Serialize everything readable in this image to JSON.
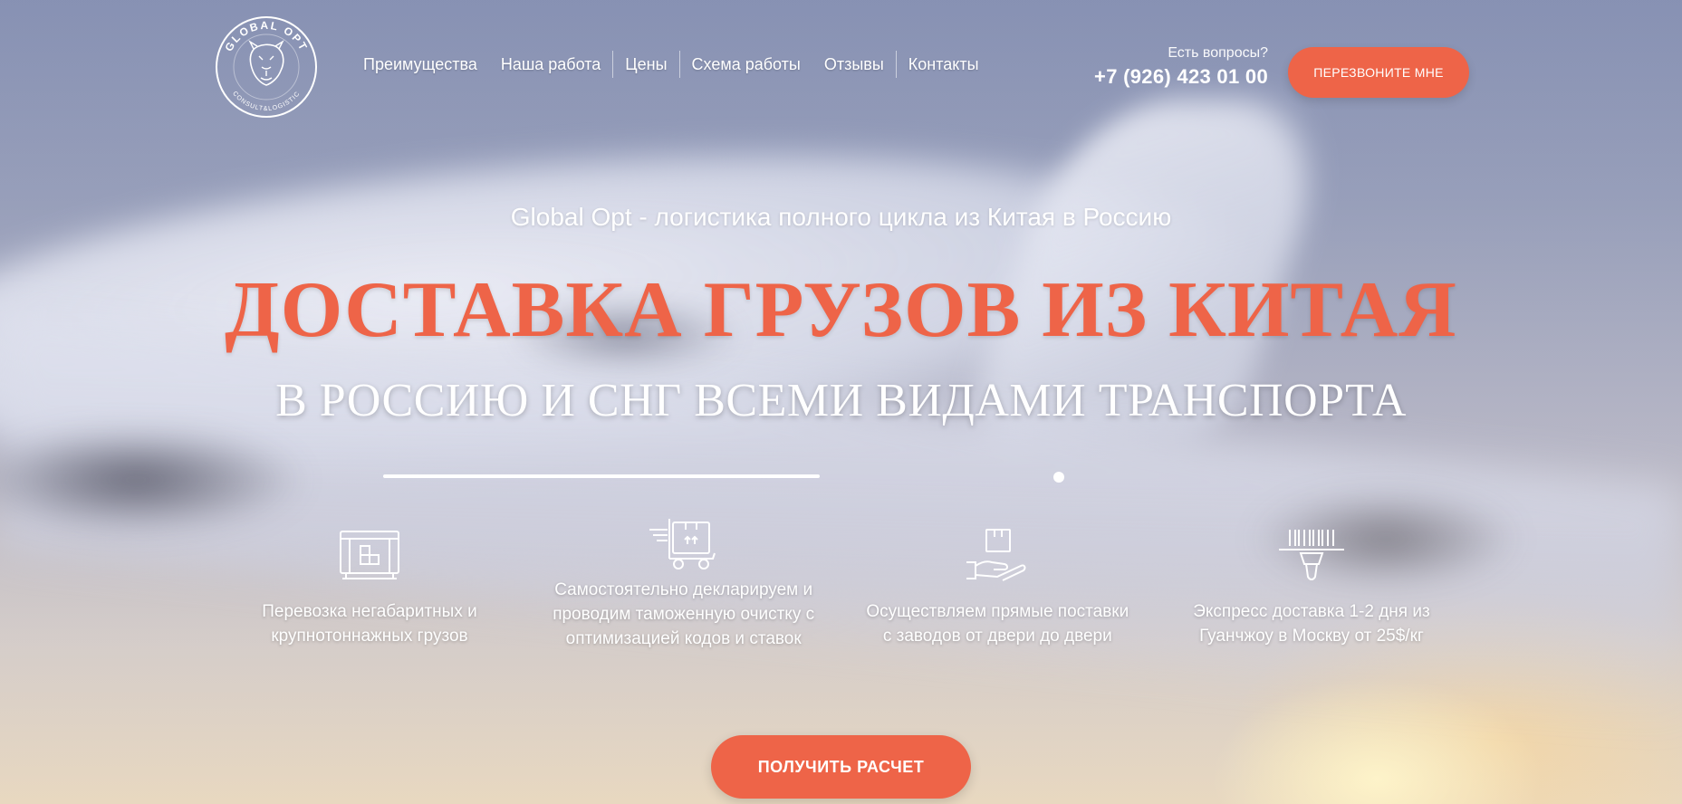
{
  "colors": {
    "accent": "#ee6448",
    "text_light": "#ffffff"
  },
  "header": {
    "logo": {
      "top_text": "GLOBAL OPT",
      "bottom_text": "CONSULT&LOGISTIC"
    },
    "nav": [
      {
        "label": "Преимущества"
      },
      {
        "label": "Наша работа"
      },
      {
        "label": "Цены"
      },
      {
        "label": "Схема работы"
      },
      {
        "label": "Отзывы"
      },
      {
        "label": "Контакты"
      }
    ],
    "contact": {
      "question": "Есть вопросы?",
      "phone": "+7 (926) 423 01 00"
    },
    "callback_button": "ПЕРЕЗВОНИТЕ МНЕ"
  },
  "hero": {
    "subtitle": "Global Opt - логистика полного цикла из Китая в Россию",
    "headline": "ДОСТАВКА ГРУЗОВ ИЗ КИТАЯ",
    "headline_sub": "В РОССИЮ И СНГ ВСЕМИ ВИДАМИ ТРАНСПОРТА",
    "features": [
      {
        "icon": "container-icon",
        "text": "Перевозка негабаритных и крупнотоннажных грузов"
      },
      {
        "icon": "delivery-cart-icon",
        "text": "Самостоятельно декларируем и проводим таможенную очистку с оптимизацией кодов и ставок"
      },
      {
        "icon": "hand-box-icon",
        "text": "Осуществляем прямые поставки с заводов от двери до двери"
      },
      {
        "icon": "barcode-scanner-icon",
        "text": "Экспресс доставка 1-2 дня из Гуанчжоу в Москву от 25$/кг"
      }
    ],
    "cta_button": "ПОЛУЧИТЬ РАСЧЕТ"
  }
}
